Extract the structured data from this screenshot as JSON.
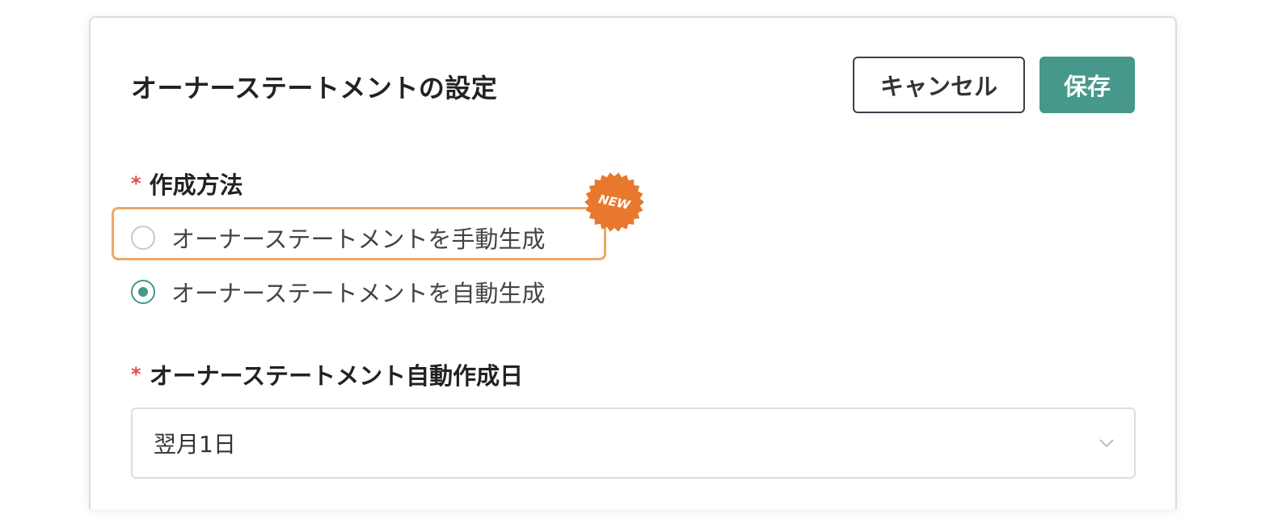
{
  "panel": {
    "title": "オーナーステートメントの設定",
    "cancel_label": "キャンセル",
    "save_label": "保存"
  },
  "method_field": {
    "required_mark": "*",
    "label": "作成方法",
    "options": [
      {
        "label": "オーナーステートメントを手動生成",
        "selected": false,
        "badge": "NEW"
      },
      {
        "label": "オーナーステートメントを自動生成",
        "selected": true
      }
    ]
  },
  "date_field": {
    "required_mark": "*",
    "label": "オーナーステートメント自動作成日",
    "selected_value": "翌月1日",
    "dropdown_icon": "chevron-down-icon"
  },
  "colors": {
    "accent": "#45988a",
    "required": "#e24c4c",
    "highlight": "#eea766",
    "badge": "#e8782d"
  }
}
